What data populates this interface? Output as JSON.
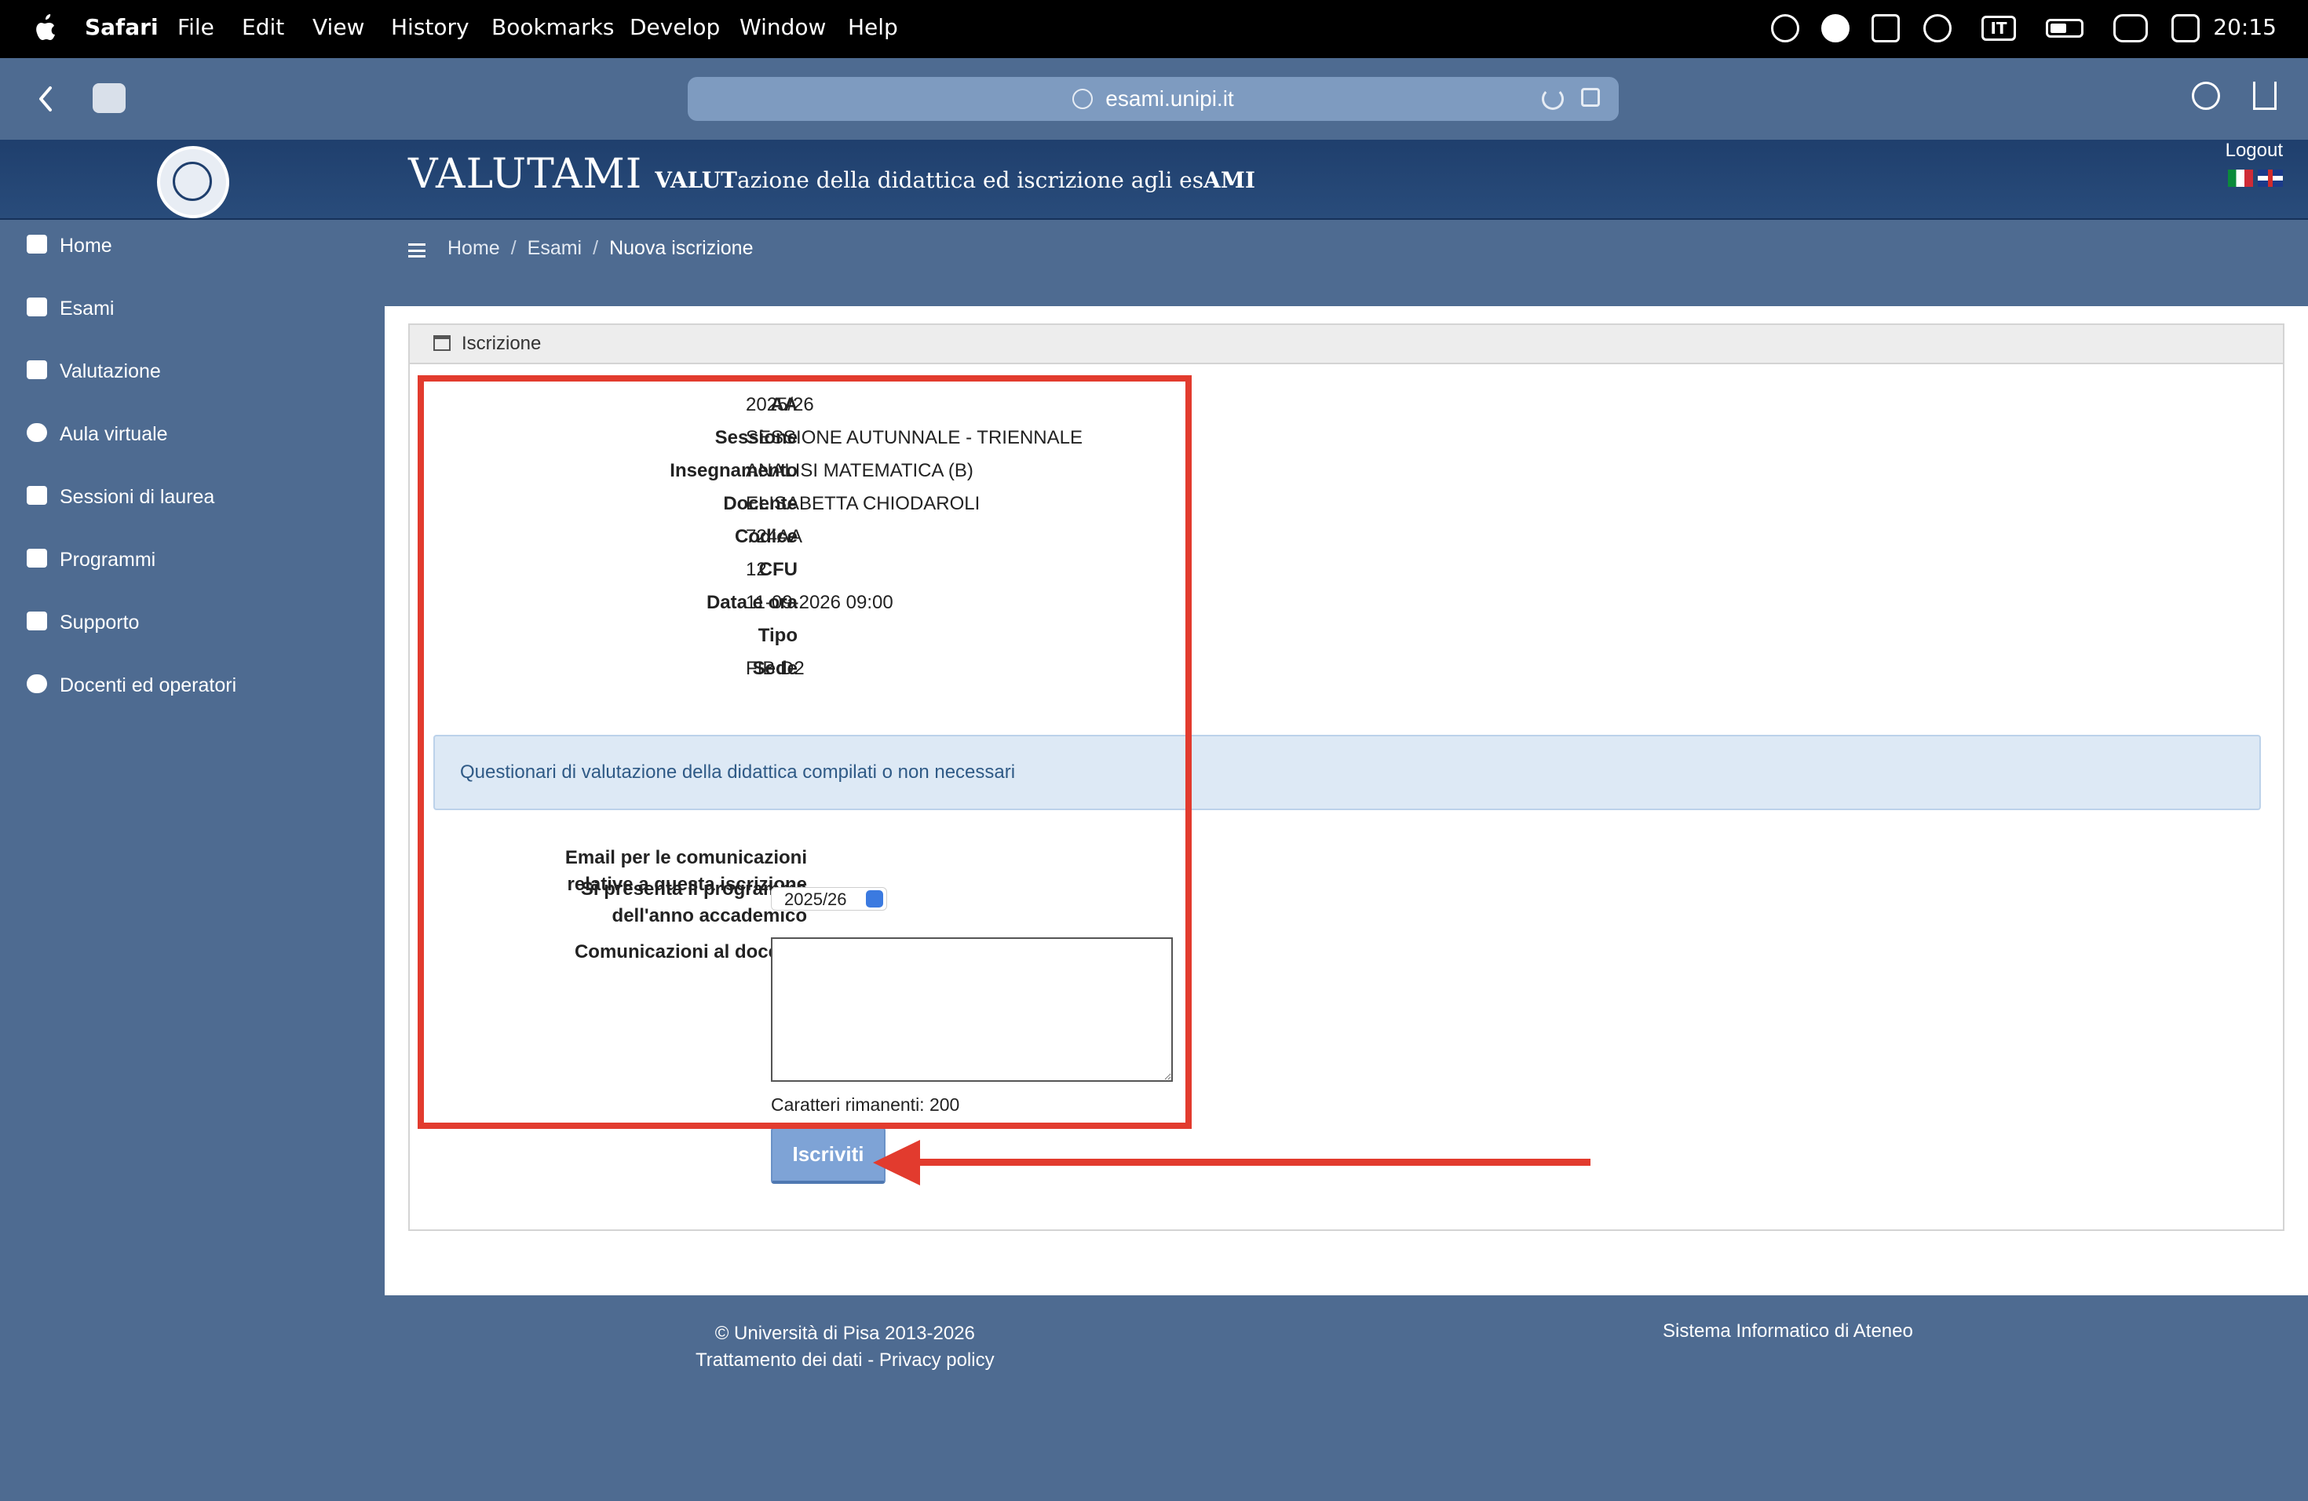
{
  "menubar": {
    "app_name": "Safari",
    "items": [
      "File",
      "Edit",
      "View",
      "History",
      "Bookmarks",
      "Develop",
      "Window",
      "Help"
    ],
    "input_source": "IT",
    "clock": "20:15"
  },
  "browser": {
    "url": "esami.unipi.it"
  },
  "site": {
    "title": "VALUTAMI",
    "subtitle_parts": [
      "VALUT",
      "azione della didattica ed iscrizione agli es",
      "AMI"
    ],
    "logout": "Logout"
  },
  "sidebar": {
    "items": [
      {
        "label": "Home",
        "icon": "home-icon"
      },
      {
        "label": "Esami",
        "icon": "calendar-icon"
      },
      {
        "label": "Valutazione",
        "icon": "edit-icon"
      },
      {
        "label": "Aula virtuale",
        "icon": "cloud-icon"
      },
      {
        "label": "Sessioni di laurea",
        "icon": "graduation-cap-icon"
      },
      {
        "label": "Programmi",
        "icon": "book-icon"
      },
      {
        "label": "Supporto",
        "icon": "wrench-icon"
      },
      {
        "label": "Docenti ed operatori",
        "icon": "dashboard-icon"
      }
    ]
  },
  "breadcrumb": {
    "items": [
      "Home",
      "Esami"
    ],
    "current": "Nuova iscrizione"
  },
  "panel": {
    "title": "Iscrizione",
    "fields": [
      {
        "label": "AA",
        "value": "2025/26"
      },
      {
        "label": "Sessione",
        "value": "SESSIONE AUTUNNALE - TRIENNALE"
      },
      {
        "label": "Insegnamento",
        "value": "ANALISI MATEMATICA (B)"
      },
      {
        "label": "Docente",
        "value": "ELISABETTA CHIODAROLI"
      },
      {
        "label": "Codice",
        "value": "724AA"
      },
      {
        "label": "CFU",
        "value": "12"
      },
      {
        "label": "Data e ora",
        "value": "11-09-2026 09:00"
      },
      {
        "label": "Tipo",
        "value": ""
      },
      {
        "label": "Sede",
        "value": "FIB D2"
      }
    ],
    "alert": "Questionari di valutazione della didattica compilati o non necessari",
    "email_label_1": "Email per le comunicazioni",
    "email_label_2": "relative a questa iscrizione",
    "program_label_1": "Si presenta il programma",
    "program_label_2": "dell'anno accademico",
    "program_selected": "2025/26",
    "comments_label": "Comunicazioni al docente",
    "comments_value": "",
    "chars_remaining": "Caratteri rimanenti: 200",
    "submit_label": "Iscriviti"
  },
  "footer": {
    "copyright": "© Università di Pisa 2013-2026",
    "privacy": "Trattamento dei dati - Privacy policy",
    "sia": "Sistema Informatico di Ateneo"
  },
  "colors": {
    "primary": "#4e6b91",
    "header": "#1f3f6d",
    "annotation": "#e23b2e",
    "button": "#7ea3d6"
  }
}
